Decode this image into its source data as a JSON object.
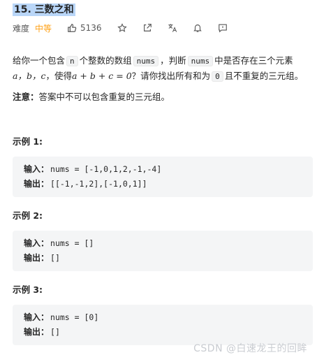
{
  "problem": {
    "title": "15. 三数之和",
    "difficulty_label": "难度",
    "difficulty": "中等",
    "likes": "5136"
  },
  "description": {
    "p1_a": "给你一个包含",
    "p1_n": "n",
    "p1_b": "个整数的数组",
    "p1_nums": "nums",
    "p1_c": "，判断",
    "p1_nums2": "nums",
    "p1_d": "中是否存在三个元素",
    "p2_abc": "a，b，c",
    "p2_a": "，使得",
    "p2_eq": "a + b + c = 0",
    "p2_b": "？请你找出所有和为",
    "p2_zero": "0",
    "p2_c": "且不重复的三元组。"
  },
  "note": {
    "label": "注意：",
    "text": "答案中不可以包含重复的三元组。"
  },
  "examples": [
    {
      "title": "示例 1:",
      "input_label": "输入：",
      "input": "nums = [-1,0,1,2,-1,-4]",
      "output_label": "输出：",
      "output": "[[-1,-1,2],[-1,0,1]]"
    },
    {
      "title": "示例 2:",
      "input_label": "输入：",
      "input": "nums = []",
      "output_label": "输出：",
      "output": "[]"
    },
    {
      "title": "示例 3:",
      "input_label": "输入：",
      "input": "nums = [0]",
      "output_label": "输出：",
      "output": "[]"
    }
  ],
  "watermark": "CSDN @白速龙王的回眸",
  "icons": [
    "thumbs-up-icon",
    "star-icon",
    "share-icon",
    "translate-icon",
    "bell-icon",
    "comment-icon"
  ],
  "colors": {
    "difficulty": "#ffa116",
    "title_highlight": "#b9d6f8",
    "example_bg": "#f4f5f6"
  }
}
